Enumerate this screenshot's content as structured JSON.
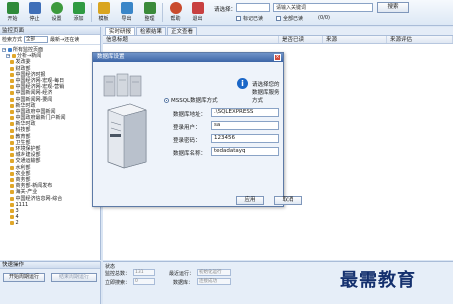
{
  "toolbar": {
    "buttons": [
      {
        "label": "开始",
        "icon": "play-icon",
        "color": "#2f8a3a"
      },
      {
        "label": "停止",
        "icon": "stop-icon",
        "color": "#3f6fb8"
      },
      {
        "label": "设置",
        "icon": "gear-icon",
        "color": "#3d9a3d"
      },
      {
        "label": "添加",
        "icon": "add-icon",
        "color": "#2f9a42"
      },
      {
        "label": "模板",
        "icon": "chart-icon",
        "color": "#d9a520"
      },
      {
        "label": "导出",
        "icon": "export-icon",
        "color": "#3a86c8"
      },
      {
        "label": "整理",
        "icon": "organize-icon",
        "color": "#3a8a3a"
      },
      {
        "label": "帮助",
        "icon": "help-icon",
        "color": "#c94b2d"
      },
      {
        "label": "退出",
        "icon": "exit-icon",
        "color": "#c84040"
      }
    ],
    "search_label": "请选择：",
    "search_select": "",
    "keyword_placeholder": "请输入关键词",
    "search_button": "搜索",
    "mark_label": "标记已读",
    "all_read_label": "全部已读",
    "count_text": "(0/0)"
  },
  "left": {
    "title": "监控页面",
    "filter_label": "检索方式",
    "filter_value": "全部",
    "filter_recent": "最新→还在读",
    "tree": [
      {
        "label": "所有监控页面",
        "level": 0,
        "kind": "root"
      },
      {
        "label": "分析→新闻",
        "level": 1,
        "kind": "folder"
      },
      {
        "label": "发改委",
        "level": 2,
        "kind": "page"
      },
      {
        "label": "财政部",
        "level": 2,
        "kind": "page"
      },
      {
        "label": "中国经济时报",
        "level": 2,
        "kind": "page"
      },
      {
        "label": "中国经济网-宏观-每日",
        "level": 2,
        "kind": "page"
      },
      {
        "label": "中国经济网-宏观-营销",
        "level": 2,
        "kind": "page"
      },
      {
        "label": "中国新闻网-经济",
        "level": 2,
        "kind": "page"
      },
      {
        "label": "中国新闻网-要闻",
        "level": 2,
        "kind": "page"
      },
      {
        "label": "新华时政",
        "level": 2,
        "kind": "page"
      },
      {
        "label": "中国政府中国新闻",
        "level": 2,
        "kind": "page"
      },
      {
        "label": "中国政府最新门户新闻",
        "level": 2,
        "kind": "page"
      },
      {
        "label": "新华时政",
        "level": 2,
        "kind": "page"
      },
      {
        "label": "科技部",
        "level": 2,
        "kind": "page"
      },
      {
        "label": "教育部",
        "level": 2,
        "kind": "page"
      },
      {
        "label": "卫生部",
        "level": 2,
        "kind": "page"
      },
      {
        "label": "环境保护部",
        "level": 2,
        "kind": "page"
      },
      {
        "label": "城乡建设部",
        "level": 2,
        "kind": "page"
      },
      {
        "label": "交通运输部",
        "level": 2,
        "kind": "page"
      },
      {
        "label": "水利部",
        "level": 2,
        "kind": "page"
      },
      {
        "label": "农业部",
        "level": 2,
        "kind": "page"
      },
      {
        "label": "商务部",
        "level": 2,
        "kind": "page"
      },
      {
        "label": "商务部-新闻发布",
        "level": 2,
        "kind": "page"
      },
      {
        "label": "海关-产业",
        "level": 2,
        "kind": "page"
      },
      {
        "label": "中国经济信息网-综合",
        "level": 2,
        "kind": "page"
      },
      {
        "label": "1111",
        "level": 2,
        "kind": "page"
      },
      {
        "label": "3",
        "level": 2,
        "kind": "page"
      },
      {
        "label": "4",
        "level": 2,
        "kind": "page"
      },
      {
        "label": "2",
        "level": 2,
        "kind": "page"
      }
    ]
  },
  "main": {
    "tabs": [
      "实时研报",
      "检索结果",
      "正文查看"
    ],
    "columns": [
      "信息标题",
      "是否已读",
      "来源",
      "来源评估"
    ]
  },
  "quick": {
    "title": "快速操作",
    "start_button": "开始周期运行",
    "stop_button": "结束周期运行"
  },
  "status": {
    "title": "状态",
    "total_label": "监控总数：",
    "total_value": "131",
    "indexed_label": "立即搜索：",
    "indexed_value": "0",
    "recent_label": "最近运行：",
    "recent_value": "初始化运行",
    "count_label": "数据库：",
    "count_value": "连接成功"
  },
  "watermark": "最需教育",
  "dialog": {
    "title": "数据库设置",
    "info_text": "请选择您的数据库服务方式",
    "radio_label": "MSSQL数据库方式",
    "fields": [
      {
        "label": "数据库地址：",
        "value": ".\\SQLEXPRESS"
      },
      {
        "label": "登录用户：",
        "value": "sa"
      },
      {
        "label": "登录密码：",
        "value": "123456"
      },
      {
        "label": "数据库名称：",
        "value": "tedadatayq"
      }
    ],
    "ok_button": "应用",
    "cancel_button": "取消"
  }
}
